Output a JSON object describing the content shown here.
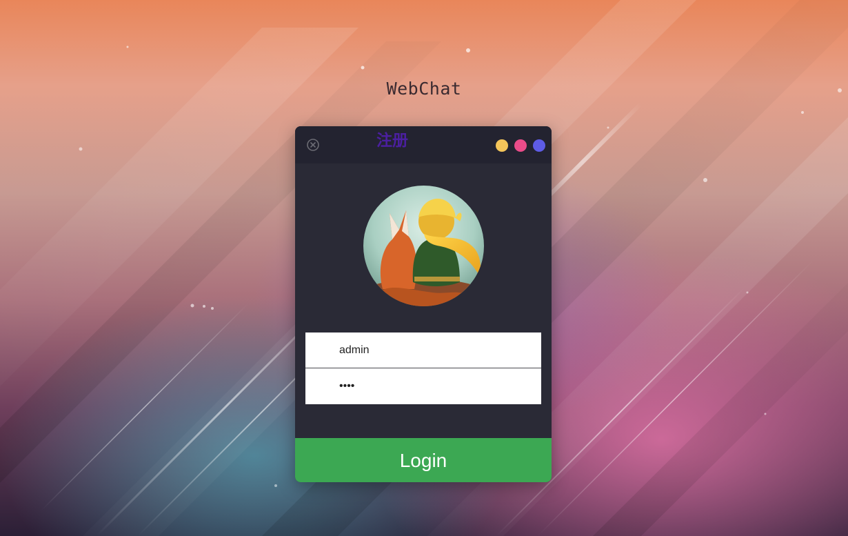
{
  "app": {
    "title": "WebChat"
  },
  "card": {
    "register_label": "注册",
    "close_icon": "close-circle-icon",
    "window_dots": [
      {
        "name": "yellow-dot",
        "color": "#f4c55a"
      },
      {
        "name": "pink-dot",
        "color": "#ea4c89"
      },
      {
        "name": "purple-dot",
        "color": "#5e5ce6"
      }
    ],
    "avatar": "little-prince-and-fox-avatar"
  },
  "form": {
    "username_value": "admin",
    "password_value": "1234",
    "login_label": "Login"
  },
  "colors": {
    "card_bg": "#2a2a36",
    "header_bg": "#232330",
    "login_button": "#3ca853",
    "register_text": "#4b1fa0"
  }
}
